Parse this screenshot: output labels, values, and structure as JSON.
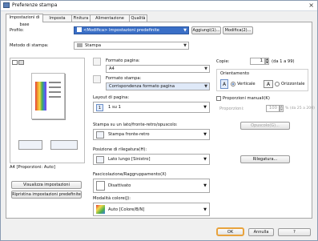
{
  "window": {
    "title": "Preferenze stampa",
    "close": "×"
  },
  "tabs": [
    "Impostazioni di base",
    "Imposta pagina",
    "Finitura",
    "Alimentazione carta",
    "Qualità"
  ],
  "profile": {
    "label": "Profilo:",
    "value": "<Modifica> Impostazioni predefinite",
    "add_button": "Aggiungi(1)...",
    "edit_button": "Modifica(2)..."
  },
  "output_method": {
    "label": "Metodo di stampa:",
    "value": "Stampa"
  },
  "preview": {
    "caption": "A4 [Proporzioni: Auto]"
  },
  "buttons": {
    "view_settings": "Visualizza impostazioni",
    "restore_defaults": "Ripristina impostazioni predefinite",
    "ok": "OK",
    "cancel": "Annulla",
    "help": "?"
  },
  "page_size": {
    "label": "Formato pagina:",
    "value": "A4"
  },
  "output_size": {
    "label": "Formato stampa:",
    "value": "Corrispondenza formato pagina"
  },
  "copies": {
    "label": "Copie:",
    "value": "1",
    "range": "(da 1 a 99)"
  },
  "orientation": {
    "label": "Orientamento",
    "portrait": "Verticale",
    "landscape": "Orizzontale",
    "icon_a": "A"
  },
  "page_layout": {
    "label": "Layout di pagina:",
    "value": "1 su 1",
    "icon_text": "1"
  },
  "manual_scaling": {
    "label": "Proporzioni manuali(K)",
    "field_label": "Proporzioni:",
    "value": "100",
    "range": "% (da 25 a 200)"
  },
  "duplex": {
    "label": "Stampa su un lato/fronte-retro/opuscolo:",
    "value": "Stampa fronte-retro"
  },
  "binding": {
    "label": "Posizione di rilegatura(H):",
    "value": "Lato lungo [Sinistro]",
    "button": "Rilegatura..."
  },
  "collate": {
    "label": "Fascicolazione/Raggruppamento(X)",
    "value": "Disattivato"
  },
  "booklet_button": "Opuscolo(G)...",
  "color_mode": {
    "label": "Modalità colore(J):",
    "value": "Auto [Colore/B/N]"
  },
  "accent_color": "#e8a33d"
}
